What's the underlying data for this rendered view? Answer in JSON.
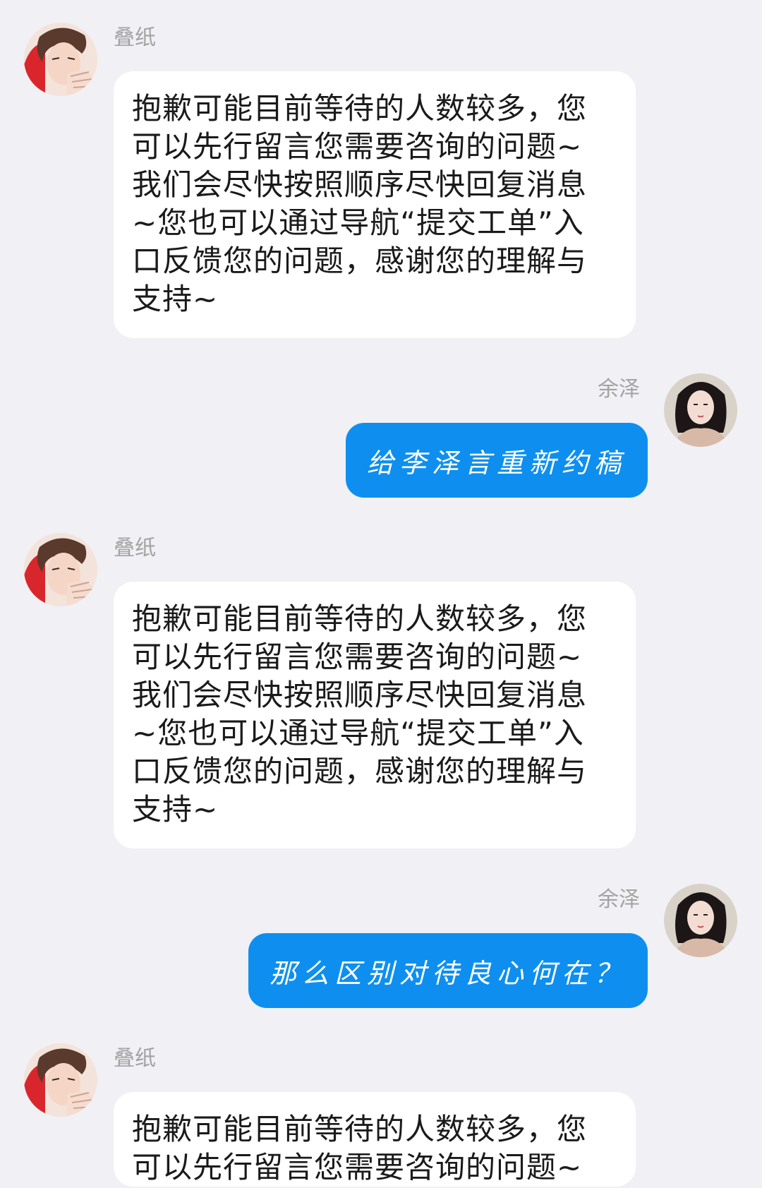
{
  "messages": [
    {
      "direction": "incoming",
      "sender": "叠纸",
      "avatar": "male-anime-avatar-icon",
      "text": "抱歉可能目前等待的人数较多，您\n可以先行留言您需要咨询的问题~\n我们会尽快按照顺序尽快回复消息\n~您也可以通过导航“提交工单”入\n口反馈您的问题，感谢您的理解与\n支持~"
    },
    {
      "direction": "outgoing",
      "sender": "余泽",
      "avatar": "female-avatar-icon",
      "text": "给李泽言重新约稿"
    },
    {
      "direction": "incoming",
      "sender": "叠纸",
      "avatar": "male-anime-avatar-icon",
      "text": "抱歉可能目前等待的人数较多，您\n可以先行留言您需要咨询的问题~\n我们会尽快按照顺序尽快回复消息\n~您也可以通过导航“提交工单”入\n口反馈您的问题，感谢您的理解与\n支持~"
    },
    {
      "direction": "outgoing",
      "sender": "余泽",
      "avatar": "female-avatar-icon",
      "text": "那么区别对待良心何在？"
    },
    {
      "direction": "incoming",
      "sender": "叠纸",
      "avatar": "male-anime-avatar-icon",
      "text": "抱歉可能目前等待的人数较多，您\n可以先行留言您需要咨询的问题~"
    }
  ],
  "colors": {
    "background": "#f0f0f5",
    "incoming_bubble": "#ffffff",
    "outgoing_bubble": "#0e8fef",
    "name_text": "#a3a3a3"
  }
}
